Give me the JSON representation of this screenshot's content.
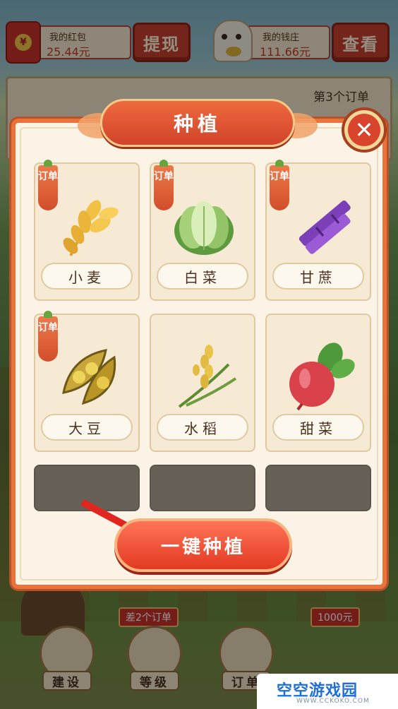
{
  "wallet": {
    "redpacket_label": "我的红包",
    "redpacket_amount": "25.44元",
    "withdraw_button": "提现",
    "bank_label": "我的钱庄",
    "bank_amount": "111.66元",
    "view_button": "查看"
  },
  "order_panel": {
    "title": "第3个订单"
  },
  "modal": {
    "title": "种植",
    "close_glyph": "✕",
    "order_tag": "订单",
    "crops": [
      {
        "name": "小麦",
        "has_order_tag": true,
        "icon": "wheat-icon"
      },
      {
        "name": "白菜",
        "has_order_tag": true,
        "icon": "cabbage-icon"
      },
      {
        "name": "甘蔗",
        "has_order_tag": true,
        "icon": "sugarcane-icon"
      },
      {
        "name": "大豆",
        "has_order_tag": true,
        "icon": "soybean-icon"
      },
      {
        "name": "水稻",
        "has_order_tag": false,
        "icon": "rice-icon"
      },
      {
        "name": "甜菜",
        "has_order_tag": false,
        "icon": "beet-icon"
      }
    ],
    "plant_all_button": "一键种植"
  },
  "bottom": {
    "hint_badge": "差2个订单",
    "price_badge": "1000元",
    "nav": [
      {
        "label": "建设",
        "icon": "building-icon"
      },
      {
        "label": "等级",
        "icon": "level-icon"
      },
      {
        "label": "订单",
        "icon": "order-scroll-icon"
      }
    ]
  },
  "watermark": {
    "name": "空空游戏园",
    "url": "WWW.CCKOKO.COM"
  },
  "colors": {
    "accent": "#e8743c",
    "button_red": "#e23a22",
    "panel": "#fbf4e6"
  }
}
